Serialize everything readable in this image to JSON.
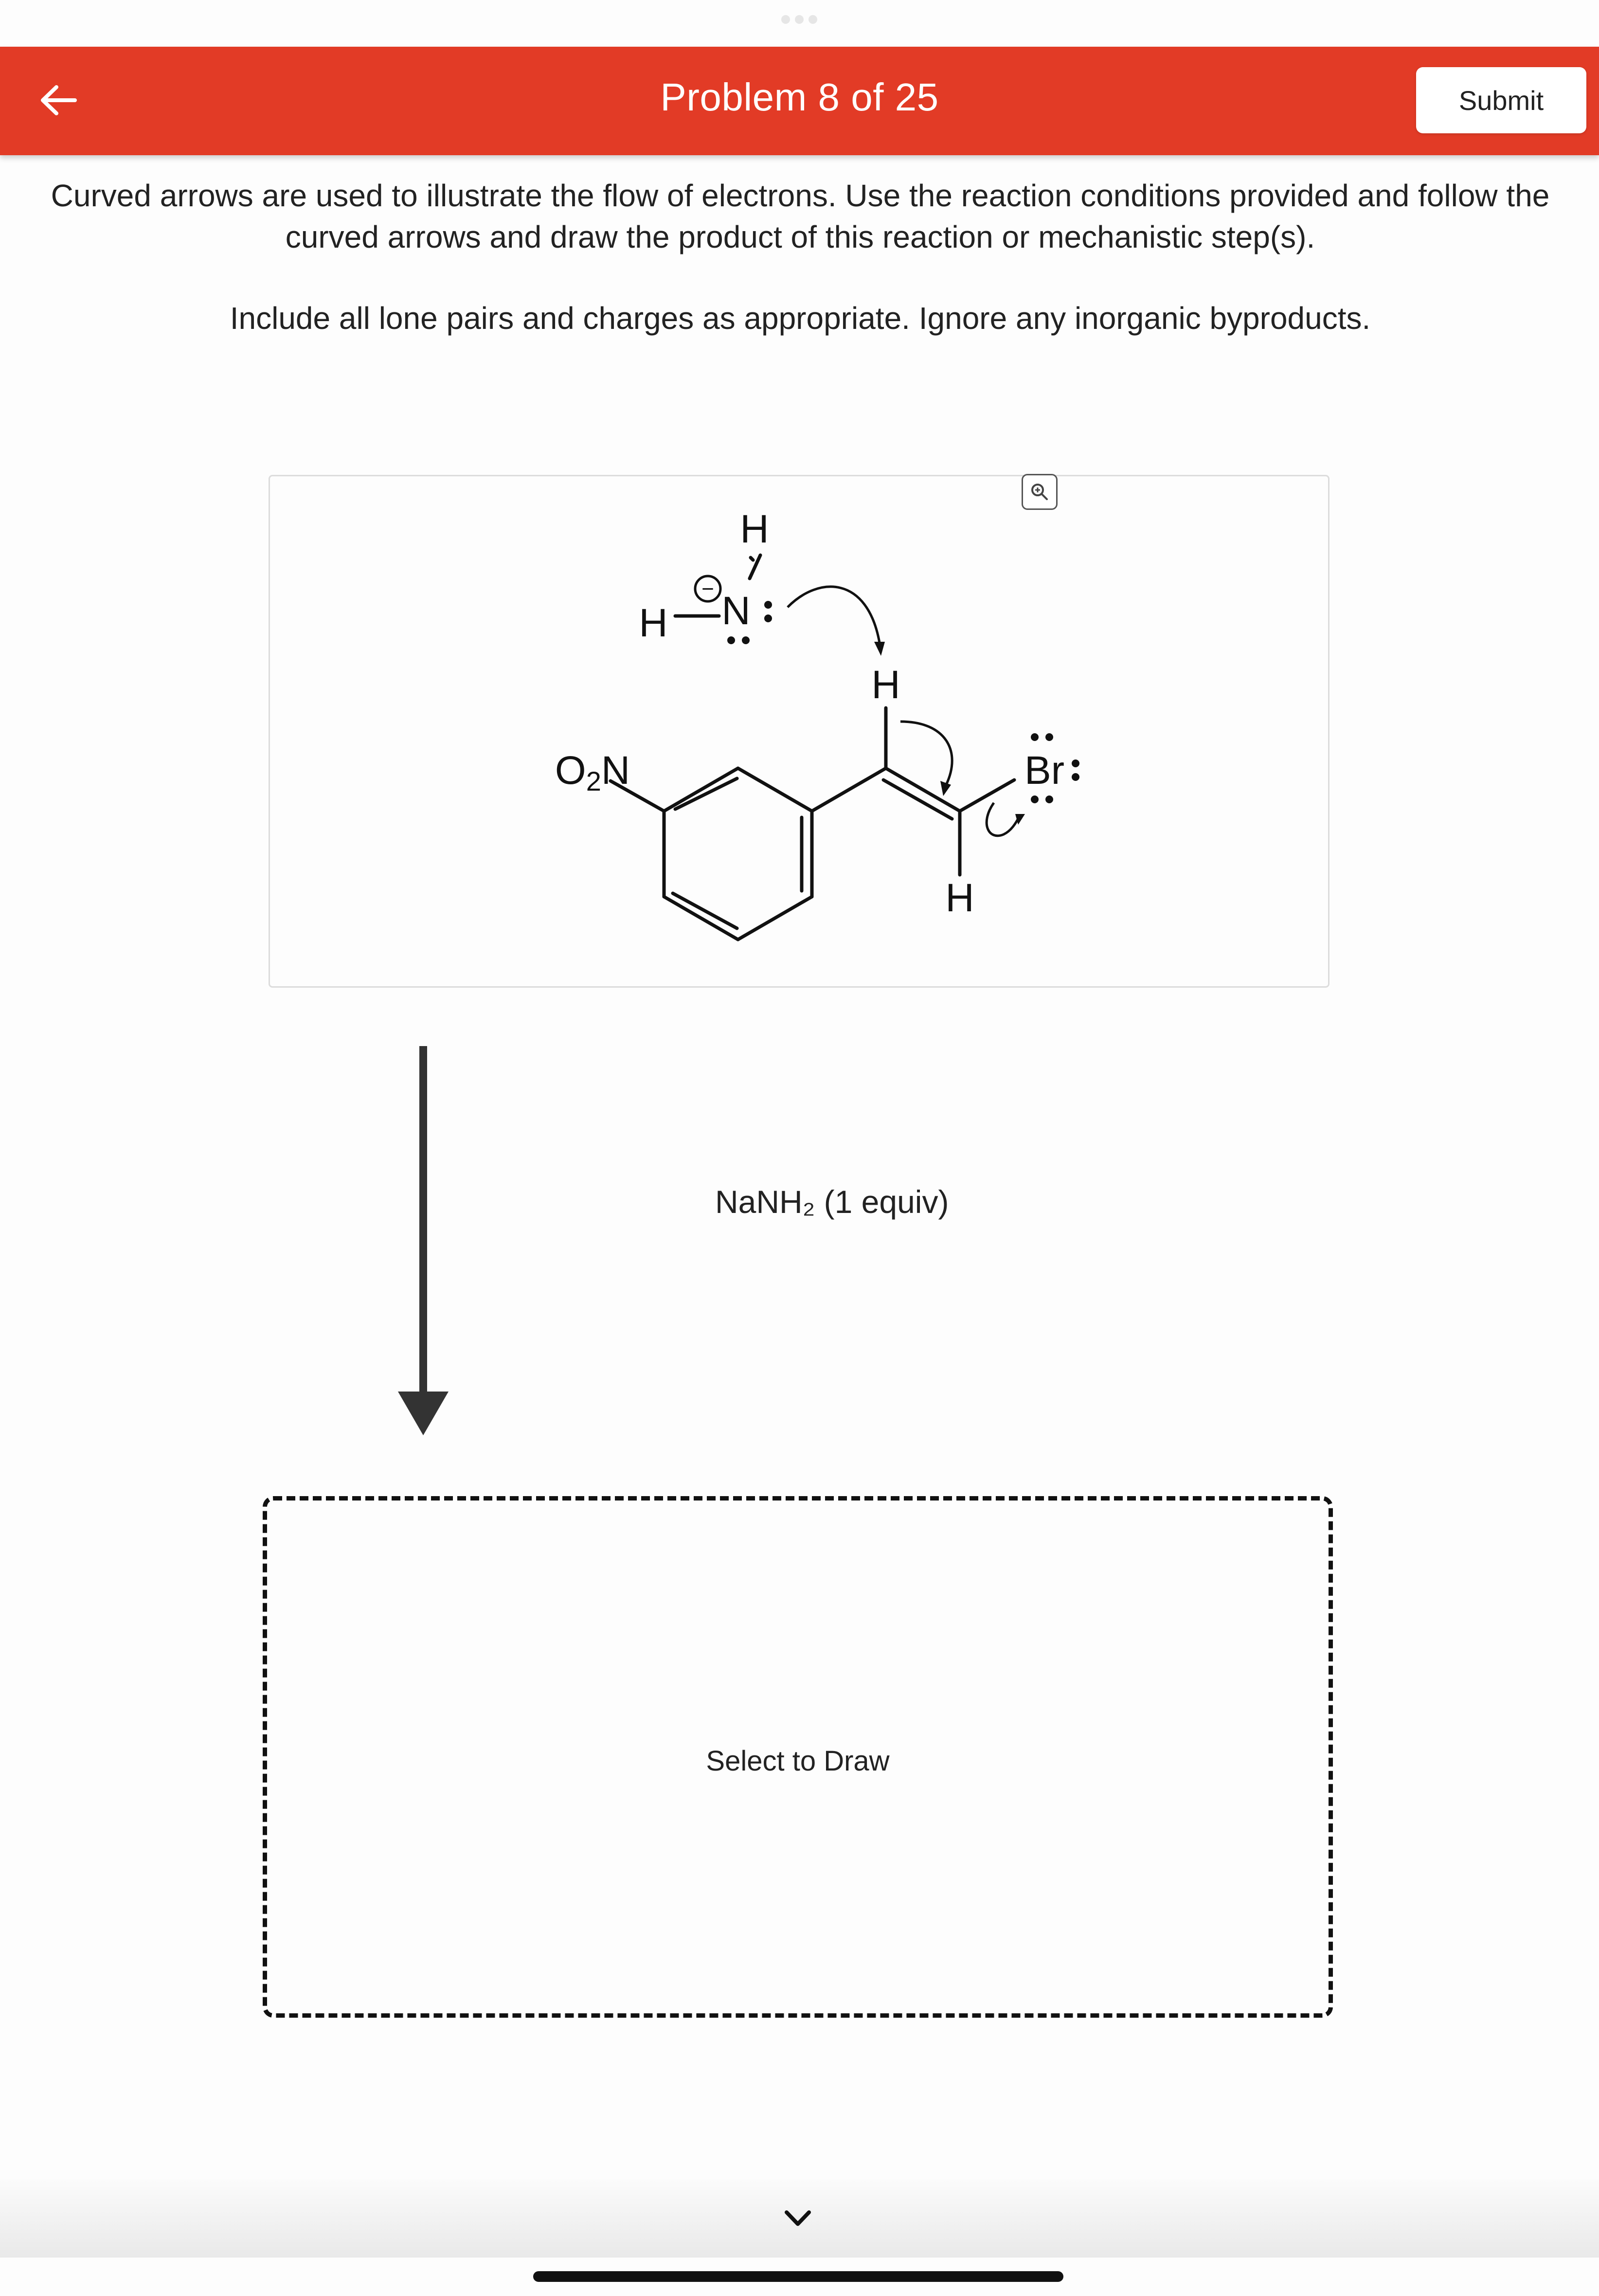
{
  "header": {
    "title": "Problem 8 of 25",
    "submit_label": "Submit",
    "back_icon": "arrow-left-icon",
    "background_color": "#e23b26"
  },
  "instructions": {
    "main": "Curved arrows are used to illustrate the flow of electrons. Use the reaction conditions provided and follow the curved arrows and draw the product of this reaction or mechanistic step(s).",
    "note": "Include all lone pairs and charges as appropriate. Ignore any inorganic byproducts."
  },
  "molecule": {
    "labels": {
      "h_amide_top": "H",
      "h_amide_left": "H",
      "n_amide": "N",
      "charge": "−",
      "o2n_o": "O",
      "o2n_sub": "2",
      "o2n_n": "N",
      "h_vinyl_top": "H",
      "h_vinyl_bottom": "H",
      "br": "Br"
    },
    "zoom_icon": "zoom-in-icon"
  },
  "reagent": "NaNH₂ (1 equiv)",
  "answer_box": {
    "label": "Select to Draw"
  },
  "footer": {
    "chevron_icon": "chevron-down-icon"
  }
}
